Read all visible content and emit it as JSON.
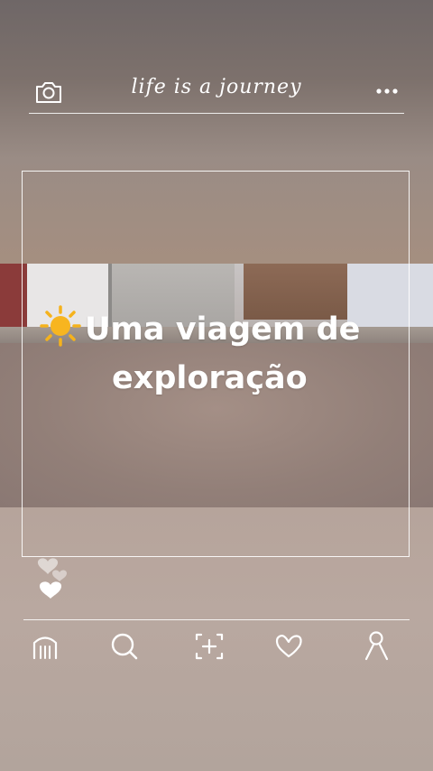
{
  "header": {
    "title": "life is a journey",
    "left_icon": "camera-icon",
    "right_icon": "more-dots-icon"
  },
  "post": {
    "caption_line1": "Uma viagem de",
    "caption_line2": "exploração",
    "caption_emoji": "sun-icon"
  },
  "decorations": {
    "hearts_icon": "hearts-icon"
  },
  "nav": {
    "items": [
      {
        "icon": "home-icon"
      },
      {
        "icon": "search-icon"
      },
      {
        "icon": "add-post-icon"
      },
      {
        "icon": "heart-icon"
      },
      {
        "icon": "profile-icon"
      }
    ]
  },
  "colors": {
    "line": "#ffffff",
    "sun": "#f5b21c"
  }
}
